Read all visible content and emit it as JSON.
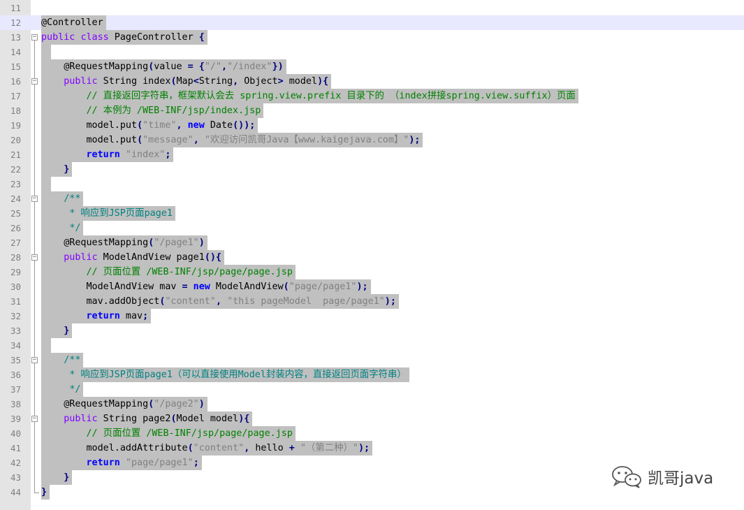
{
  "editor": {
    "current_line": 12,
    "lines": [
      {
        "n": "11",
        "fold": "",
        "segs": []
      },
      {
        "n": "12",
        "fold": "",
        "segs": [
          [
            "ann",
            "@Controller"
          ]
        ]
      },
      {
        "n": "13",
        "fold": "open",
        "segs": [
          [
            "kw2",
            "public"
          ],
          [
            "tx",
            " "
          ],
          [
            "kw2",
            "class"
          ],
          [
            "tx",
            " PageController "
          ],
          [
            "op",
            "{"
          ]
        ]
      },
      {
        "n": "14",
        "fold": "line",
        "segs": [],
        "empty": true
      },
      {
        "n": "15",
        "fold": "line",
        "segs": [
          [
            "tx",
            "    @RequestMapping"
          ],
          [
            "op",
            "("
          ],
          [
            "tx",
            "value "
          ],
          [
            "op",
            "="
          ],
          [
            "tx",
            " "
          ],
          [
            "op",
            "{"
          ],
          [
            "str",
            "\"/\""
          ],
          [
            "op",
            ","
          ],
          [
            "str",
            "\"/index\""
          ],
          [
            "op",
            "})"
          ]
        ]
      },
      {
        "n": "16",
        "fold": "open",
        "segs": [
          [
            "tx",
            "    "
          ],
          [
            "kw2",
            "public"
          ],
          [
            "tx",
            " String index"
          ],
          [
            "op",
            "("
          ],
          [
            "tx",
            "Map"
          ],
          [
            "op",
            "<"
          ],
          [
            "tx",
            "String"
          ],
          [
            "op",
            ","
          ],
          [
            "tx",
            " Object"
          ],
          [
            "op",
            ">"
          ],
          [
            "tx",
            " model"
          ],
          [
            "op",
            "){"
          ]
        ]
      },
      {
        "n": "17",
        "fold": "line",
        "segs": [
          [
            "tx",
            "        "
          ],
          [
            "cm",
            "// 直接返回字符串，框架默认会去 spring.view.prefix 目录下的 （index拼接spring.view.suffix）页面"
          ]
        ]
      },
      {
        "n": "18",
        "fold": "line",
        "segs": [
          [
            "tx",
            "        "
          ],
          [
            "cm",
            "// 本例为 /WEB-INF/jsp/index.jsp"
          ]
        ]
      },
      {
        "n": "19",
        "fold": "line",
        "segs": [
          [
            "tx",
            "        model.put"
          ],
          [
            "op",
            "("
          ],
          [
            "str",
            "\"time\""
          ],
          [
            "op",
            ","
          ],
          [
            "tx",
            " "
          ],
          [
            "kw",
            "new"
          ],
          [
            "tx",
            " Date"
          ],
          [
            "op",
            "());"
          ]
        ]
      },
      {
        "n": "20",
        "fold": "line",
        "segs": [
          [
            "tx",
            "        model.put"
          ],
          [
            "op",
            "("
          ],
          [
            "str",
            "\"message\""
          ],
          [
            "op",
            ","
          ],
          [
            "tx",
            " "
          ],
          [
            "str",
            "\"欢迎访问凯哥Java【www.kaigejava.com】\""
          ],
          [
            "op",
            ");"
          ]
        ]
      },
      {
        "n": "21",
        "fold": "line",
        "segs": [
          [
            "tx",
            "        "
          ],
          [
            "kw",
            "return"
          ],
          [
            "tx",
            " "
          ],
          [
            "str",
            "\"index\""
          ],
          [
            "op",
            ";"
          ]
        ]
      },
      {
        "n": "22",
        "fold": "end",
        "segs": [
          [
            "tx",
            "    "
          ],
          [
            "op",
            "}"
          ]
        ]
      },
      {
        "n": "23",
        "fold": "line",
        "segs": [],
        "empty": true
      },
      {
        "n": "24",
        "fold": "open",
        "segs": [
          [
            "tx",
            "    "
          ],
          [
            "doc",
            "/**"
          ]
        ]
      },
      {
        "n": "25",
        "fold": "line",
        "segs": [
          [
            "tx",
            "     "
          ],
          [
            "doc",
            "* 响应到JSP页面page1"
          ]
        ]
      },
      {
        "n": "26",
        "fold": "end",
        "segs": [
          [
            "tx",
            "     "
          ],
          [
            "doc",
            "*/"
          ]
        ]
      },
      {
        "n": "27",
        "fold": "line",
        "segs": [
          [
            "tx",
            "    @RequestMapping"
          ],
          [
            "op",
            "("
          ],
          [
            "str",
            "\"/page1\""
          ],
          [
            "op",
            ")"
          ]
        ]
      },
      {
        "n": "28",
        "fold": "open",
        "segs": [
          [
            "tx",
            "    "
          ],
          [
            "kw2",
            "public"
          ],
          [
            "tx",
            " ModelAndView page1"
          ],
          [
            "op",
            "(){"
          ]
        ]
      },
      {
        "n": "29",
        "fold": "line",
        "segs": [
          [
            "tx",
            "        "
          ],
          [
            "cm",
            "// 页面位置 /WEB-INF/jsp/page/page.jsp"
          ]
        ]
      },
      {
        "n": "30",
        "fold": "line",
        "segs": [
          [
            "tx",
            "        ModelAndView mav "
          ],
          [
            "op",
            "="
          ],
          [
            "tx",
            " "
          ],
          [
            "kw",
            "new"
          ],
          [
            "tx",
            " ModelAndView"
          ],
          [
            "op",
            "("
          ],
          [
            "str",
            "\"page/page1\""
          ],
          [
            "op",
            ");"
          ]
        ]
      },
      {
        "n": "31",
        "fold": "line",
        "segs": [
          [
            "tx",
            "        mav.addObject"
          ],
          [
            "op",
            "("
          ],
          [
            "str",
            "\"content\""
          ],
          [
            "op",
            ","
          ],
          [
            "tx",
            " "
          ],
          [
            "str",
            "\"this pageModel  page/page1\""
          ],
          [
            "op",
            ");"
          ]
        ]
      },
      {
        "n": "32",
        "fold": "line",
        "segs": [
          [
            "tx",
            "        "
          ],
          [
            "kw",
            "return"
          ],
          [
            "tx",
            " mav"
          ],
          [
            "op",
            ";"
          ]
        ]
      },
      {
        "n": "33",
        "fold": "end",
        "segs": [
          [
            "tx",
            "    "
          ],
          [
            "op",
            "}"
          ]
        ]
      },
      {
        "n": "34",
        "fold": "line",
        "segs": [],
        "empty": true
      },
      {
        "n": "35",
        "fold": "open",
        "segs": [
          [
            "tx",
            "    "
          ],
          [
            "doc",
            "/**"
          ]
        ]
      },
      {
        "n": "36",
        "fold": "line",
        "segs": [
          [
            "tx",
            "     "
          ],
          [
            "doc",
            "* 响应到JSP页面page1（可以直接使用Model封装内容，直接返回页面字符串）"
          ]
        ]
      },
      {
        "n": "37",
        "fold": "end",
        "segs": [
          [
            "tx",
            "     "
          ],
          [
            "doc",
            "*/"
          ]
        ]
      },
      {
        "n": "38",
        "fold": "line",
        "segs": [
          [
            "tx",
            "    @RequestMapping"
          ],
          [
            "op",
            "("
          ],
          [
            "str",
            "\"/page2\""
          ],
          [
            "op",
            ")"
          ]
        ]
      },
      {
        "n": "39",
        "fold": "open",
        "segs": [
          [
            "tx",
            "    "
          ],
          [
            "kw2",
            "public"
          ],
          [
            "tx",
            " String page2"
          ],
          [
            "op",
            "("
          ],
          [
            "tx",
            "Model model"
          ],
          [
            "op",
            "){"
          ]
        ]
      },
      {
        "n": "40",
        "fold": "line",
        "segs": [
          [
            "tx",
            "        "
          ],
          [
            "cm",
            "// 页面位置 /WEB-INF/jsp/page/page.jsp"
          ]
        ]
      },
      {
        "n": "41",
        "fold": "line",
        "segs": [
          [
            "tx",
            "        model.addAttribute"
          ],
          [
            "op",
            "("
          ],
          [
            "str",
            "\"content\""
          ],
          [
            "op",
            ","
          ],
          [
            "tx",
            " hello "
          ],
          [
            "op",
            "+"
          ],
          [
            "tx",
            " "
          ],
          [
            "str",
            "\"（第二种）\""
          ],
          [
            "op",
            ");"
          ]
        ]
      },
      {
        "n": "42",
        "fold": "line",
        "segs": [
          [
            "tx",
            "        "
          ],
          [
            "kw",
            "return"
          ],
          [
            "tx",
            " "
          ],
          [
            "str",
            "\"page/page1\""
          ],
          [
            "op",
            ";"
          ]
        ]
      },
      {
        "n": "43",
        "fold": "end",
        "segs": [
          [
            "tx",
            "    "
          ],
          [
            "op",
            "}"
          ]
        ]
      },
      {
        "n": "44",
        "fold": "last",
        "segs": [
          [
            "op",
            "}"
          ]
        ]
      }
    ]
  },
  "watermark": {
    "text": "凯哥java",
    "icon": "wechat-icon"
  }
}
